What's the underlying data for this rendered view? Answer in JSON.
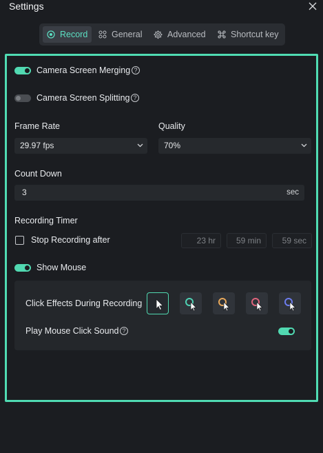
{
  "window": {
    "title": "Settings"
  },
  "tabs": [
    {
      "label": "Record",
      "icon": "record-icon",
      "active": true
    },
    {
      "label": "General",
      "icon": "general-icon",
      "active": false
    },
    {
      "label": "Advanced",
      "icon": "advanced-gear-icon",
      "active": false
    },
    {
      "label": "Shortcut key",
      "icon": "command-key-icon",
      "active": false
    }
  ],
  "record": {
    "camera_merging": {
      "label": "Camera Screen Merging",
      "on": true
    },
    "camera_splitting": {
      "label": "Camera Screen Splitting",
      "on": false
    },
    "frame_rate": {
      "label": "Frame Rate",
      "value": "29.97 fps"
    },
    "quality": {
      "label": "Quality",
      "value": "70%"
    },
    "count_down": {
      "label": "Count Down",
      "value": "3",
      "unit": "sec"
    },
    "timer": {
      "label": "Recording Timer",
      "stop_label": "Stop Recording after",
      "checked": false,
      "hours": "23 hr",
      "minutes": "59 min",
      "seconds": "59 sec"
    },
    "show_mouse": {
      "label": "Show Mouse",
      "on": true
    },
    "click_effects": {
      "label": "Click Effects During Recording",
      "options": [
        {
          "name": "plain-cursor",
          "color": "#ffffff",
          "selected": true
        },
        {
          "name": "ring-teal",
          "color": "#4fd2b4",
          "selected": false
        },
        {
          "name": "ring-orange",
          "color": "#e8a85a",
          "selected": false
        },
        {
          "name": "ring-pink",
          "color": "#e0647c",
          "selected": false
        },
        {
          "name": "ring-blue",
          "color": "#6d7df0",
          "selected": false
        }
      ]
    },
    "click_sound": {
      "label": "Play Mouse Click Sound",
      "on": true
    }
  },
  "colors": {
    "accent": "#51d9b1",
    "highlight_border": "#50dcb3",
    "background": "#1b1d21"
  }
}
